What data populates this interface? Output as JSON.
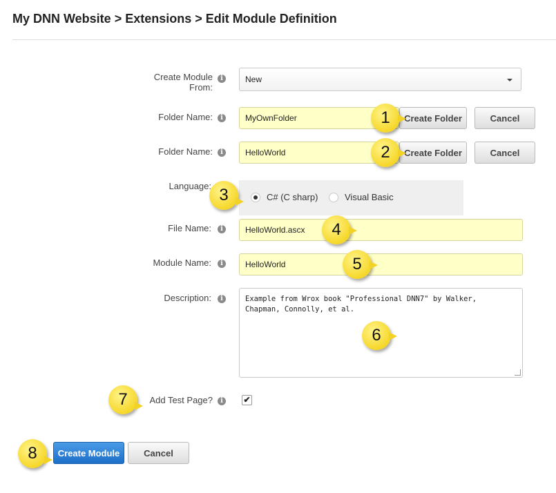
{
  "breadcrumb": "My DNN Website > Extensions > Edit Module Definition",
  "form": {
    "create_from": {
      "label": "Create Module From:",
      "value": "New"
    },
    "folder1": {
      "label": "Folder Name:",
      "value": "MyOwnFolder",
      "create_btn": "Create Folder",
      "cancel_btn": "Cancel"
    },
    "folder2": {
      "label": "Folder Name:",
      "value": "HelloWorld",
      "create_btn": "Create Folder",
      "cancel_btn": "Cancel"
    },
    "language": {
      "label": "Language:",
      "options": [
        "C# (C sharp)",
        "Visual Basic"
      ],
      "selected": "C# (C sharp)"
    },
    "file_name": {
      "label": "File Name:",
      "value": "HelloWorld.ascx"
    },
    "module_name": {
      "label": "Module Name:",
      "value": "HelloWorld"
    },
    "description": {
      "label": "Description:",
      "line1": "Example from Wrox book \"Professional DNN7\" by Walker,",
      "line2": "Chapman, Connolly, et al."
    },
    "add_test_page": {
      "label": "Add Test Page?",
      "checked": true,
      "check_glyph": "✔"
    }
  },
  "actions": {
    "create_module": "Create Module",
    "cancel": "Cancel"
  },
  "callouts": [
    "1",
    "2",
    "3",
    "4",
    "5",
    "6",
    "7",
    "8"
  ],
  "info_glyph": "i",
  "colors": {
    "highlight": "#ffffc8",
    "primary": "#1d6fc9",
    "callout": "#f6d72a"
  }
}
